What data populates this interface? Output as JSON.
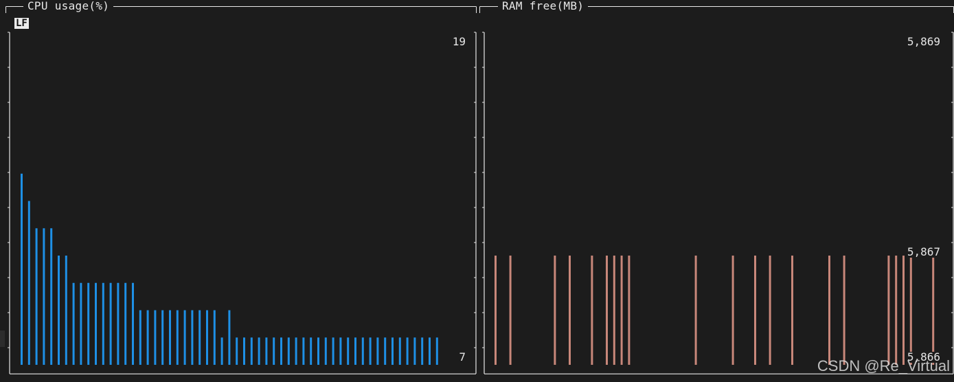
{
  "badge": "LF",
  "watermark": "CSDN @Re_Virtual",
  "theme": {
    "background": "#1c1c1c",
    "frame": "#e8e8e8",
    "cpu_bar": "#1e90e6",
    "ram_bar": "#c8877a"
  },
  "chart_data": [
    {
      "type": "bar",
      "title": "CPU usage(%)",
      "ylim": [
        7,
        19
      ],
      "y_labels": {
        "top": "19",
        "bottom": "7"
      },
      "color": "#1e90e6",
      "values": [
        14,
        13,
        12,
        12,
        12,
        11,
        11,
        10,
        10,
        10,
        10,
        10,
        10,
        10,
        10,
        10,
        9,
        9,
        9,
        9,
        9,
        9,
        9,
        9,
        9,
        9,
        9,
        8,
        9,
        8,
        8,
        8,
        8,
        8,
        8,
        8,
        8,
        8,
        8,
        8,
        8,
        8,
        8,
        8,
        8,
        8,
        8,
        8,
        8,
        8,
        8,
        8,
        8,
        8,
        8,
        8,
        8
      ]
    },
    {
      "type": "bar",
      "title": "RAM free(MB)",
      "ylim": [
        5866,
        5869
      ],
      "y_labels": {
        "top": "5,869",
        "middle": "5,867",
        "bottom": "5,866"
      },
      "color": "#c8877a",
      "values": [
        5867,
        5866,
        5867,
        5866,
        5866,
        5866,
        5866,
        5866,
        5867,
        5866,
        5867,
        5866,
        5866,
        5867,
        5866,
        5867,
        5867,
        5867,
        5867,
        5866,
        5866,
        5866,
        5866,
        5866,
        5866,
        5866,
        5866,
        5867,
        5866,
        5866,
        5866,
        5866,
        5867,
        5866,
        5866,
        5867,
        5866,
        5867,
        5866,
        5866,
        5867,
        5866,
        5866,
        5866,
        5866,
        5867,
        5866,
        5867,
        5866,
        5866,
        5866,
        5866,
        5866,
        5867,
        5867,
        5867,
        5867,
        5866,
        5866,
        5867
      ]
    }
  ]
}
